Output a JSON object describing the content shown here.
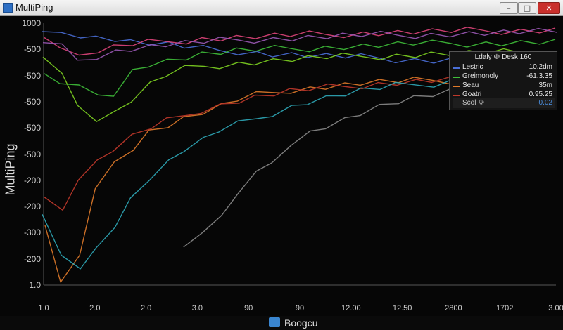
{
  "window": {
    "title": "MultiPing",
    "icon": "app-icon",
    "controls": {
      "minimize": "–",
      "maximize": "□",
      "close": "✕"
    }
  },
  "chart_data": {
    "type": "line",
    "ylabel": "MultiPing",
    "y_ticks": [
      "1000",
      "-500",
      "-500",
      "-500",
      "-500",
      "-500",
      "-200",
      "-200",
      "-300",
      "-200",
      "1.0"
    ],
    "x_ticks": [
      "1.0",
      "2.0",
      "2.0",
      "3.0",
      "90",
      "90",
      "12.00",
      "12.50",
      "2800",
      "1702",
      "3.00"
    ],
    "grid": false,
    "legend_placement": "top-right",
    "legend": {
      "title": "Ldaly ☫ Desk 160",
      "entries": [
        {
          "name": "Lestric",
          "value": "10.2dm",
          "color": "#4a6fd8"
        },
        {
          "name": "Greimonoly",
          "value": "-61.3.35",
          "color": "#3fbf3a"
        },
        {
          "name": "Seau",
          "value": "35m",
          "color": "#e07a2a"
        },
        {
          "name": "Goatri",
          "value": "0.95.25",
          "color": "#c0392b"
        }
      ],
      "footer_label": "Scol ☫",
      "footer_value": "0.02"
    },
    "series": [
      {
        "color": "#4a6fd8",
        "values": [
          -190,
          -180,
          -185,
          -195,
          -200,
          -210,
          -215,
          -220,
          -228,
          -235,
          -238,
          -240,
          -245,
          -250,
          -252,
          -255,
          -258,
          -260,
          -262,
          -264,
          -266,
          -268,
          -270,
          -271,
          -272,
          -273,
          -274,
          -275,
          -276,
          -277
        ]
      },
      {
        "color": "#3fbf3a",
        "values": [
          -320,
          -340,
          -360,
          -380,
          -400,
          -300,
          -280,
          -270,
          -260,
          -250,
          -245,
          -240,
          -238,
          -235,
          -232,
          -230,
          -228,
          -226,
          -224,
          -222,
          -220,
          -218,
          -218,
          -216,
          -215,
          -214,
          -214,
          -213,
          -212,
          -212
        ]
      },
      {
        "color": "#7ed321",
        "values": [
          -260,
          -300,
          -420,
          -460,
          -440,
          -400,
          -350,
          -320,
          -300,
          -290,
          -285,
          -280,
          -276,
          -272,
          -268,
          -265,
          -262,
          -260,
          -258,
          -256,
          -254,
          -252,
          -250,
          -249,
          -248,
          -247,
          -246,
          -245,
          -244,
          -243
        ]
      },
      {
        "color": "#e07a2a",
        "values": [
          -800,
          -1000,
          -900,
          -700,
          -600,
          -550,
          -500,
          -480,
          -460,
          -440,
          -420,
          -400,
          -385,
          -375,
          -365,
          -360,
          -355,
          -350,
          -345,
          -342,
          -340,
          -338,
          -336,
          -334,
          -332,
          -330,
          -328,
          -326,
          -325,
          -324
        ]
      },
      {
        "color": "#c0392b",
        "values": [
          -700,
          -760,
          -650,
          -600,
          -560,
          -520,
          -490,
          -470,
          -450,
          -430,
          -415,
          -400,
          -390,
          -380,
          -372,
          -366,
          -360,
          -355,
          -350,
          -346,
          -342,
          -339,
          -336,
          -333,
          -330,
          -328,
          -326,
          -324,
          -322,
          -320
        ]
      },
      {
        "color": "#2fa8b8",
        "values": [
          -780,
          -900,
          -960,
          -880,
          -800,
          -720,
          -650,
          -600,
          -560,
          -530,
          -500,
          -480,
          -460,
          -440,
          -420,
          -405,
          -392,
          -380,
          -370,
          -362,
          -355,
          -350,
          -345,
          -340,
          -336,
          -333,
          -330,
          -328,
          -326,
          -324
        ]
      },
      {
        "color": "#e0457b",
        "values": [
          -200,
          -220,
          -260,
          -240,
          -230,
          -220,
          -215,
          -210,
          -205,
          -200,
          -198,
          -196,
          -194,
          -192,
          -190,
          -188,
          -186,
          -184,
          -182,
          -181,
          -180,
          -179,
          -178,
          -177,
          -176,
          -175,
          -174,
          -173,
          -172,
          -172
        ]
      },
      {
        "color": "#9b59b6",
        "values": [
          -210,
          -230,
          -270,
          -255,
          -240,
          -232,
          -226,
          -220,
          -216,
          -212,
          -208,
          -205,
          -202,
          -200,
          -198,
          -196,
          -194,
          -192,
          -190,
          -189,
          -188,
          -187,
          -186,
          -185,
          -184,
          -183,
          -182,
          -181,
          -180,
          -180
        ]
      },
      {
        "color": "#8a8a8a",
        "values": [
          null,
          null,
          null,
          null,
          null,
          null,
          null,
          null,
          -880,
          -820,
          -780,
          -700,
          -640,
          -600,
          -560,
          -500,
          -480,
          -460,
          -440,
          -420,
          -405,
          -395,
          -385,
          -378,
          -372,
          -366,
          -360,
          -356,
          -352,
          -350
        ]
      }
    ]
  },
  "bottom": {
    "label": "Boogcu",
    "icon": "bookmark-icon"
  }
}
